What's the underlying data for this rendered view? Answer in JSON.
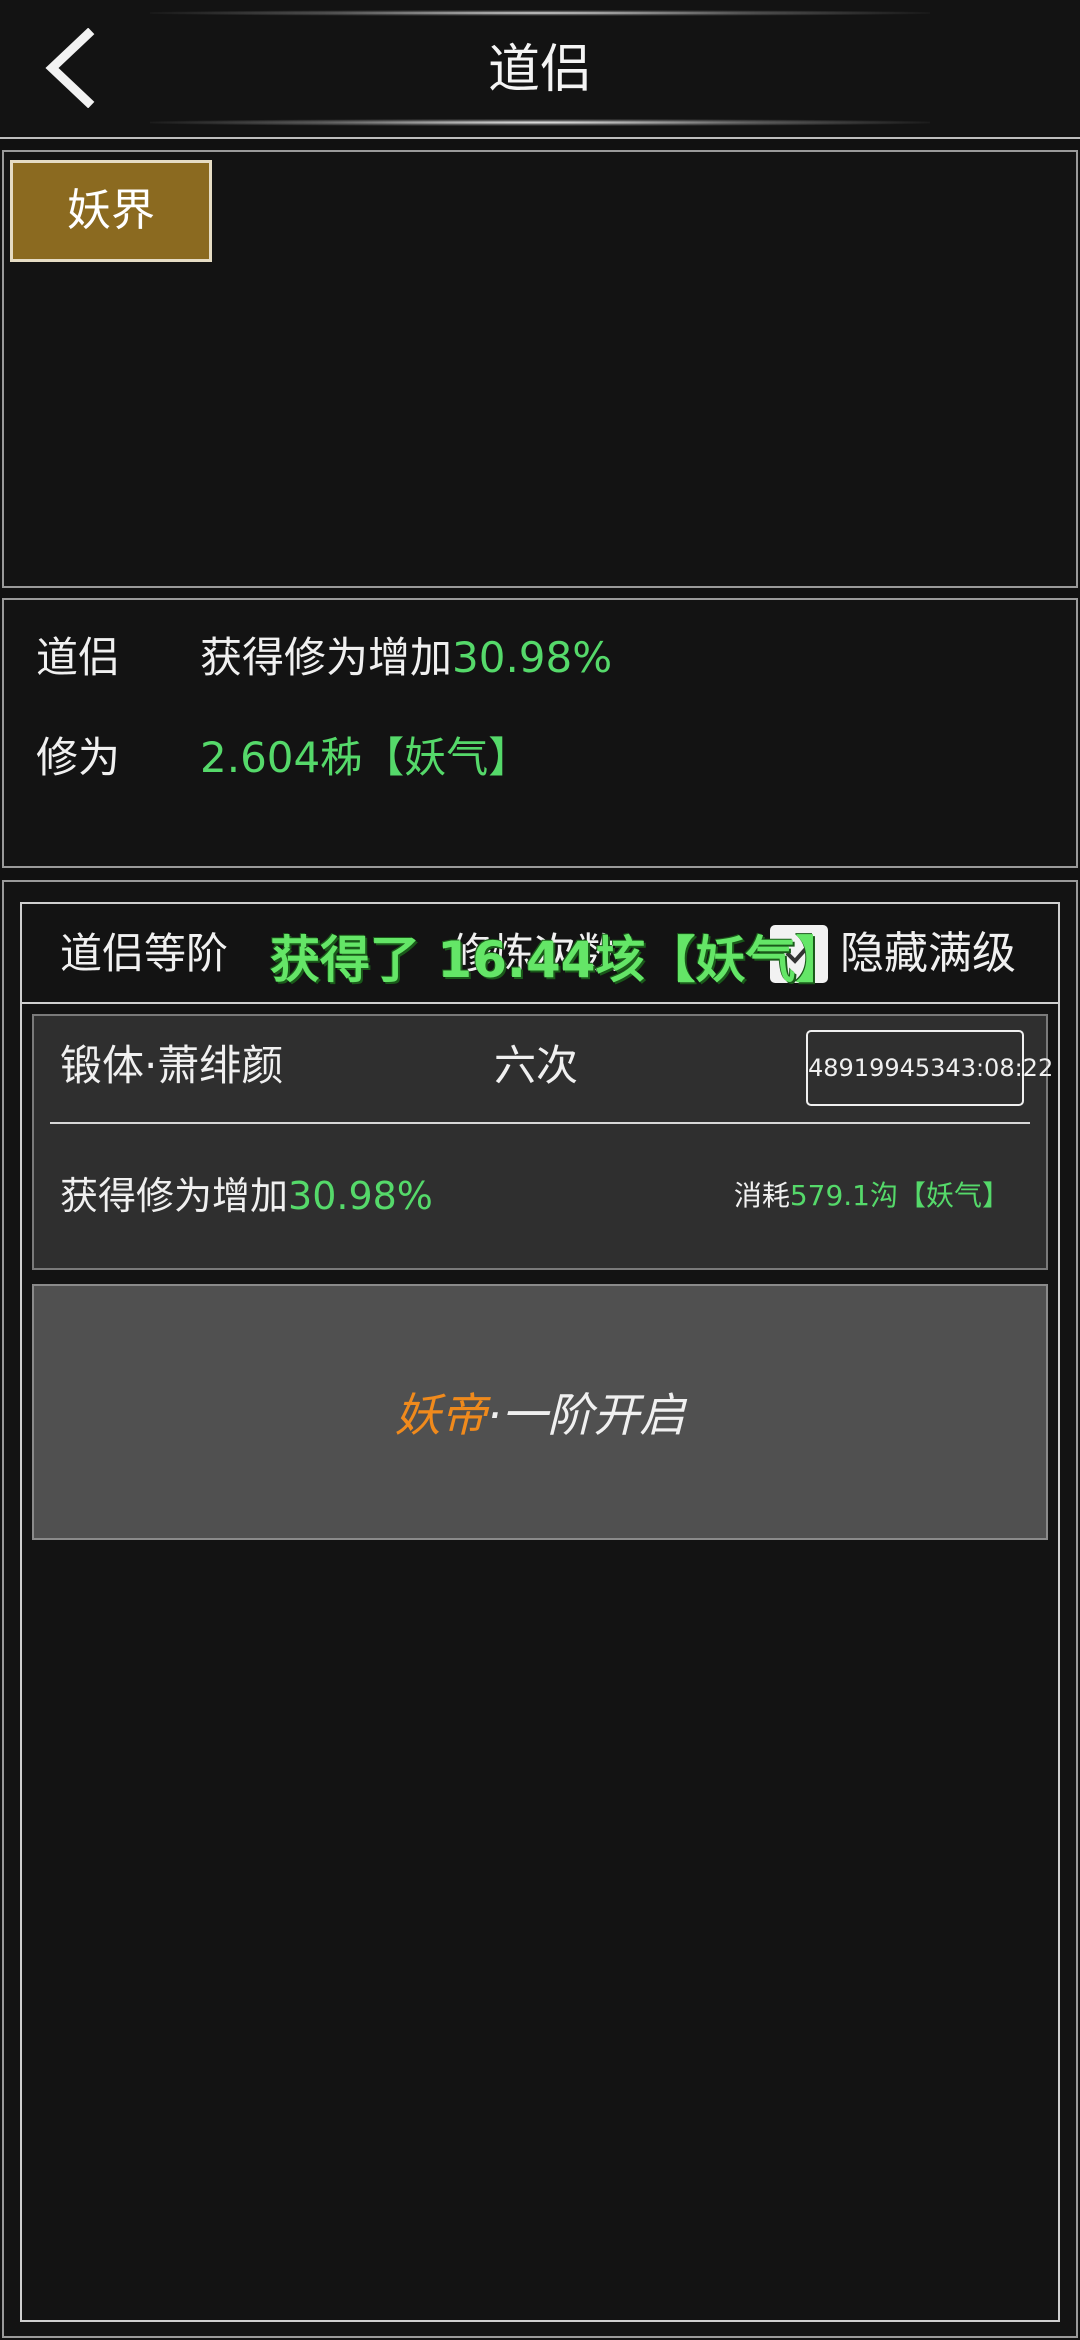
{
  "header": {
    "title": "道侣",
    "back_icon": "chevron-left-icon"
  },
  "realm_tabs": [
    {
      "label": "妖界",
      "selected": true
    }
  ],
  "summary": {
    "row1_label": "道侣",
    "row1_text": "获得修为增加",
    "row1_value": "30.98%",
    "row2_label": "修为",
    "row2_value": "2.604秭【妖气】"
  },
  "list_header": {
    "col1": "道侣等阶",
    "col2": "修炼次数",
    "checkbox_checked": true,
    "checkbox_label": "隐藏满级"
  },
  "toast": "获得了 16.44垓【妖气】",
  "items": [
    {
      "name": "锻体·萧绯颜",
      "count": "六次",
      "timer": "48919945343:08:22",
      "effect_text": "获得修为增加",
      "effect_value": "30.98%",
      "cost_label": "消耗",
      "cost_value": "579.1沟【妖气】"
    }
  ],
  "unlock": {
    "highlight": "妖帝",
    "rest": "·一阶开启"
  },
  "colors": {
    "green": "#55d96a",
    "orange": "#f08a1c",
    "tab_gold": "#8b6a20"
  }
}
